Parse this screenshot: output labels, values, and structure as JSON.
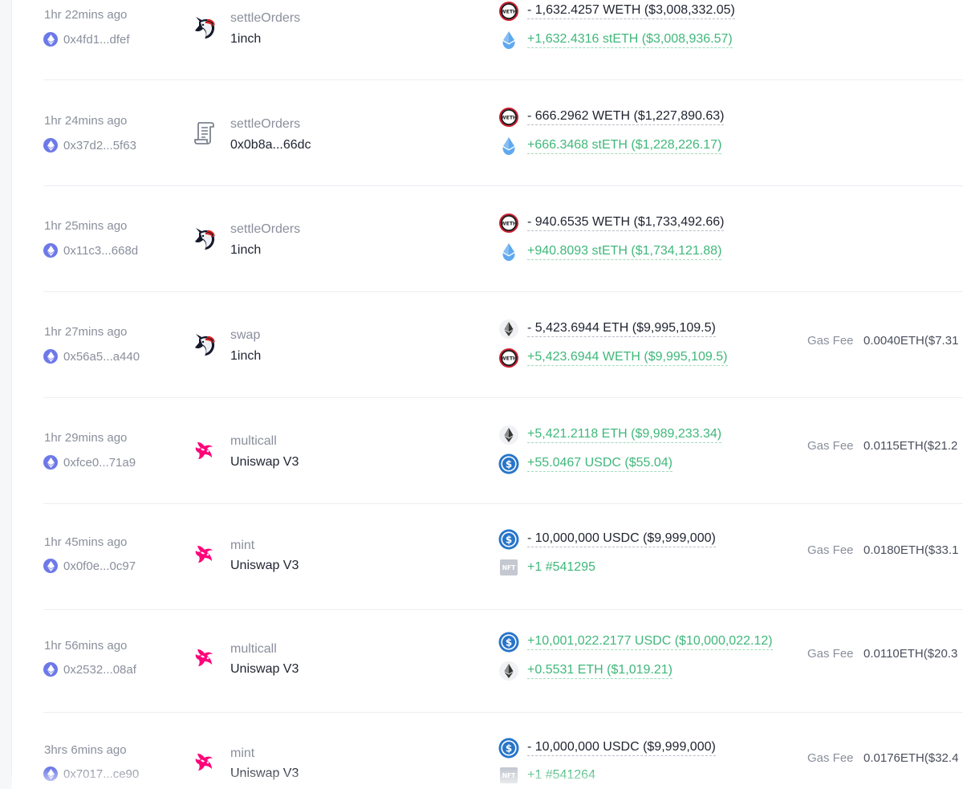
{
  "colors": {
    "positive": "#3fb87a",
    "negative": "#1f2330",
    "muted": "#8a8f9c",
    "usdc": "#2775ca",
    "steth": "#5ea9f0",
    "weth_ring": "#c8202f",
    "uniswap": "#ff007a",
    "oneinch_mane": "#d82122",
    "eth_chain": "#6d79e8",
    "nft_badge": "#c4c8d0"
  },
  "gas_label": "Gas Fee",
  "transactions": [
    {
      "time": "1hr 22mins ago",
      "hash": "0x4fd1...dfef",
      "method": "settleOrders",
      "protocol": "1inch",
      "protocol_icon": "oneinch-unicorn-icon",
      "tokens": [
        {
          "icon": "weth-icon",
          "amount": "- 1,632.4257 WETH ($3,008,332.05)",
          "direction": "out"
        },
        {
          "icon": "steth-icon",
          "amount": "+1,632.4316 stETH ($3,008,936.57)",
          "direction": "in"
        }
      ],
      "gas": null
    },
    {
      "time": "1hr 24mins ago",
      "hash": "0x37d2...5f63",
      "method": "settleOrders",
      "protocol": "0x0b8a...66dc",
      "protocol_icon": "contract-scroll-icon",
      "tokens": [
        {
          "icon": "weth-icon",
          "amount": "- 666.2962 WETH ($1,227,890.63)",
          "direction": "out"
        },
        {
          "icon": "steth-icon",
          "amount": "+666.3468 stETH ($1,228,226.17)",
          "direction": "in"
        }
      ],
      "gas": null
    },
    {
      "time": "1hr 25mins ago",
      "hash": "0x11c3...668d",
      "method": "settleOrders",
      "protocol": "1inch",
      "protocol_icon": "oneinch-unicorn-icon",
      "tokens": [
        {
          "icon": "weth-icon",
          "amount": "- 940.6535 WETH ($1,733,492.66)",
          "direction": "out"
        },
        {
          "icon": "steth-icon",
          "amount": "+940.8093 stETH ($1,734,121.88)",
          "direction": "in"
        }
      ],
      "gas": null
    },
    {
      "time": "1hr 27mins ago",
      "hash": "0x56a5...a440",
      "method": "swap",
      "protocol": "1inch",
      "protocol_icon": "oneinch-unicorn-icon",
      "tokens": [
        {
          "icon": "eth-icon",
          "amount": "- 5,423.6944 ETH ($9,995,109.5)",
          "direction": "out"
        },
        {
          "icon": "weth-icon",
          "amount": "+5,423.6944 WETH ($9,995,109.5)",
          "direction": "in"
        }
      ],
      "gas": "0.0040ETH($7.31"
    },
    {
      "time": "1hr 29mins ago",
      "hash": "0xfce0...71a9",
      "method": "multicall",
      "protocol": "Uniswap V3",
      "protocol_icon": "uniswap-unicorn-icon",
      "tokens": [
        {
          "icon": "eth-icon",
          "amount": "+5,421.2118 ETH ($9,989,233.34)",
          "direction": "in"
        },
        {
          "icon": "usdc-icon",
          "amount": "+55.0467 USDC ($55.04)",
          "direction": "in"
        }
      ],
      "gas": "0.0115ETH($21.2"
    },
    {
      "time": "1hr 45mins ago",
      "hash": "0x0f0e...0c97",
      "method": "mint",
      "protocol": "Uniswap V3",
      "protocol_icon": "uniswap-unicorn-icon",
      "tokens": [
        {
          "icon": "usdc-icon",
          "amount": "- 10,000,000 USDC ($9,999,000)",
          "direction": "out"
        },
        {
          "icon": "nft-icon",
          "amount": "+1 #541295",
          "direction": "nft",
          "badge": "NFT"
        }
      ],
      "gas": "0.0180ETH($33.1"
    },
    {
      "time": "1hr 56mins ago",
      "hash": "0x2532...08af",
      "method": "multicall",
      "protocol": "Uniswap V3",
      "protocol_icon": "uniswap-unicorn-icon",
      "tokens": [
        {
          "icon": "usdc-icon",
          "amount": "+10,001,022.2177 USDC ($10,000,022.12)",
          "direction": "in"
        },
        {
          "icon": "eth-icon",
          "amount": "+0.5531 ETH ($1,019.21)",
          "direction": "in"
        }
      ],
      "gas": "0.0110ETH($20.3"
    },
    {
      "time": "3hrs 6mins ago",
      "hash": "0x7017...ce90",
      "method": "mint",
      "protocol": "Uniswap V3",
      "protocol_icon": "uniswap-unicorn-icon",
      "tokens": [
        {
          "icon": "usdc-icon",
          "amount": "- 10,000,000 USDC ($9,999,000)",
          "direction": "out"
        },
        {
          "icon": "nft-icon",
          "amount": "+1 #541264",
          "direction": "nft",
          "badge": "NFT"
        }
      ],
      "gas": "0.0176ETH($32.4"
    }
  ]
}
